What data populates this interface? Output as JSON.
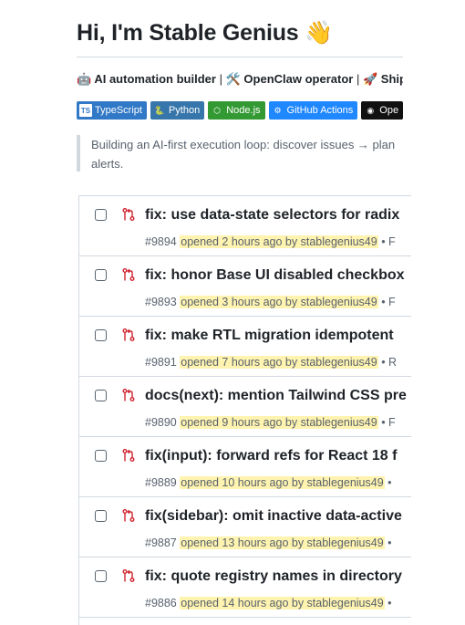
{
  "profile": {
    "heading": "Hi, I'm Stable Genius 👋",
    "tagline": {
      "part1_emoji": "🤖",
      "part1": "AI automation builder",
      "sep1": "|",
      "part2_emoji": "🛠️",
      "part2": "OpenClaw operator",
      "sep2": "|",
      "part3_emoji": "🚀",
      "part3": "Shipp"
    },
    "badges": [
      {
        "label": "TypeScript",
        "color": "#3178c6",
        "icon": "typescript-icon",
        "glyph": "TS"
      },
      {
        "label": "Python",
        "color": "#3776ab",
        "icon": "python-icon",
        "glyph": "🐍"
      },
      {
        "label": "Node.js",
        "color": "#339933",
        "icon": "nodejs-icon",
        "glyph": "⬡"
      },
      {
        "label": "GitHub Actions",
        "color": "#2088ff",
        "icon": "github-actions-icon",
        "glyph": "⚙"
      },
      {
        "label": "Ope",
        "color": "#111111",
        "icon": "openai-icon",
        "glyph": "◉"
      }
    ],
    "quote": {
      "line1": "Building an AI-first execution loop: discover issues → plan",
      "line2": "alerts."
    }
  },
  "pull_requests": [
    {
      "title": "fix: use data-state selectors for radix",
      "number": "#9894",
      "opened": "opened 2 hours ago by stablegenius49",
      "trail": "• F"
    },
    {
      "title": "fix: honor Base UI disabled checkbox",
      "number": "#9893",
      "opened": "opened 3 hours ago by stablegenius49",
      "trail": "• F"
    },
    {
      "title": "fix: make RTL migration idempotent",
      "number": "#9891",
      "opened": "opened 7 hours ago by stablegenius49",
      "trail": "• R"
    },
    {
      "title": "docs(next): mention Tailwind CSS pre",
      "number": "#9890",
      "opened": "opened 9 hours ago by stablegenius49",
      "trail": "• F"
    },
    {
      "title": "fix(input): forward refs for React 18 f",
      "number": "#9889",
      "opened": "opened 10 hours ago by stablegenius49",
      "trail": "•"
    },
    {
      "title": "fix(sidebar): omit inactive data-active",
      "number": "#9887",
      "opened": "opened 13 hours ago by stablegenius49",
      "trail": "•"
    },
    {
      "title": "fix: quote registry names in directory",
      "number": "#9886",
      "opened": "opened 14 hours ago by stablegenius49",
      "trail": "•"
    }
  ],
  "colors": {
    "pr_icon": "#cf222e",
    "highlight": "#fff3b0"
  }
}
